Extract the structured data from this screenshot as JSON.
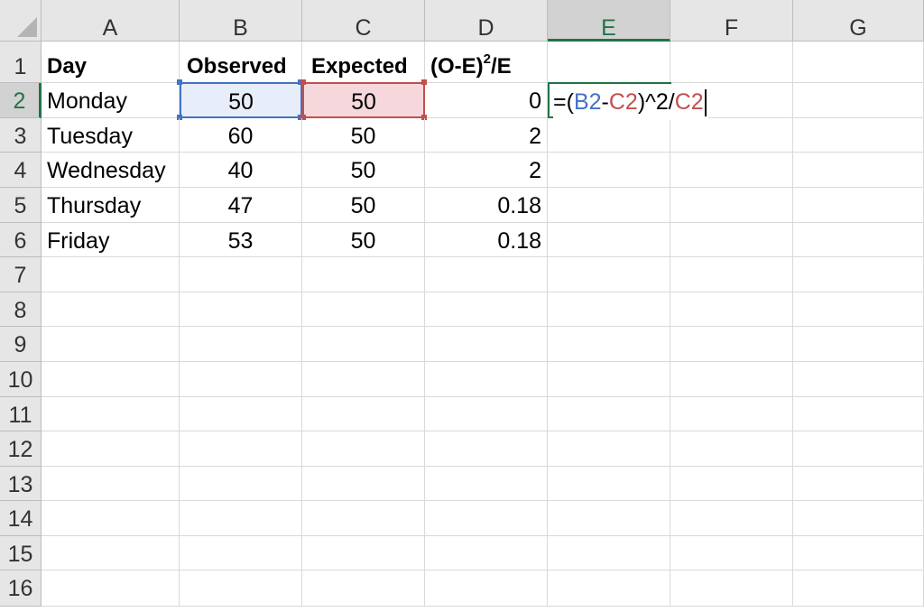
{
  "columns": [
    "A",
    "B",
    "C",
    "D",
    "E",
    "F",
    "G"
  ],
  "rows": [
    "1",
    "2",
    "3",
    "4",
    "5",
    "6",
    "7",
    "8",
    "9",
    "10",
    "11",
    "12",
    "13",
    "14",
    "15",
    "16"
  ],
  "headers": {
    "A1": "Day",
    "B1": "Observed",
    "C1": "Expected",
    "D1_base": "(O-E)",
    "D1_sup": "2",
    "D1_tail": "/E"
  },
  "data": [
    {
      "day": "Monday",
      "observed": "50",
      "expected": "50",
      "chi": "0"
    },
    {
      "day": "Tuesday",
      "observed": "60",
      "expected": "50",
      "chi": "2"
    },
    {
      "day": "Wednesday",
      "observed": "40",
      "expected": "50",
      "chi": "2"
    },
    {
      "day": "Thursday",
      "observed": "47",
      "expected": "50",
      "chi": "0.18"
    },
    {
      "day": "Friday",
      "observed": "53",
      "expected": "50",
      "chi": "0.18"
    }
  ],
  "active_cell": {
    "column": "E",
    "row": "2",
    "formula_parts": [
      "=(",
      "B2",
      "-",
      "C2",
      ")^2/",
      "C2"
    ]
  },
  "colors": {
    "ref_b": "#4472c4",
    "ref_c": "#c0504d",
    "active": "#217346"
  }
}
